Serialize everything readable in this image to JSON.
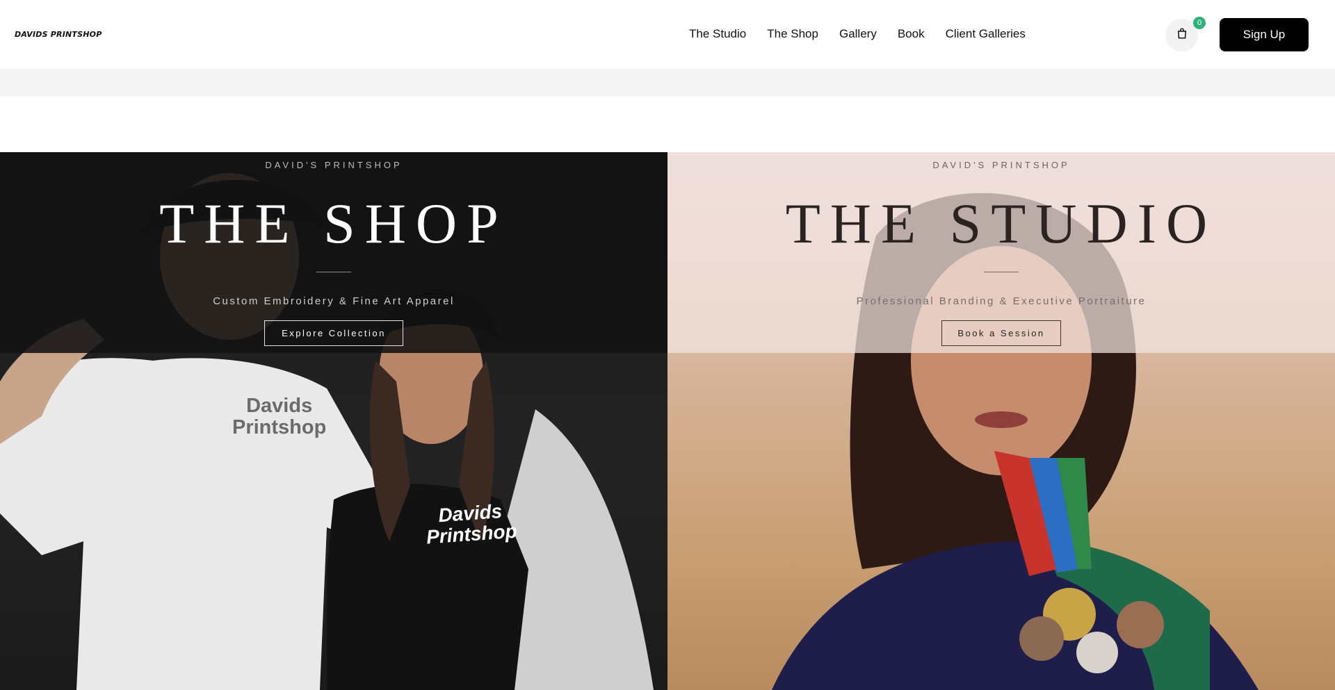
{
  "header": {
    "logo": "DAVIDS PRINTSHOP",
    "nav": [
      "The Studio",
      "The Shop",
      "Gallery",
      "Book",
      "Client Galleries"
    ],
    "cart_count": "0",
    "signup_label": "Sign Up"
  },
  "shop": {
    "kicker": "DAVID'S PRINTSHOP",
    "title": "THE SHOP",
    "subtitle": "Custom Embroidery & Fine Art Apparel",
    "cta": "Explore Collection",
    "shirt_white_text_1": "Davids",
    "shirt_white_text_2": "Printshop",
    "shirt_black_text_1": "Davids",
    "shirt_black_text_2": "Printshop"
  },
  "studio": {
    "kicker": "DAVID'S PRINTSHOP",
    "title": "THE STUDIO",
    "subtitle": "Professional Branding & Executive Portraiture",
    "cta": "Book a Session"
  },
  "colors": {
    "accent_badge": "#2fb277",
    "signup_bg": "#000000"
  }
}
